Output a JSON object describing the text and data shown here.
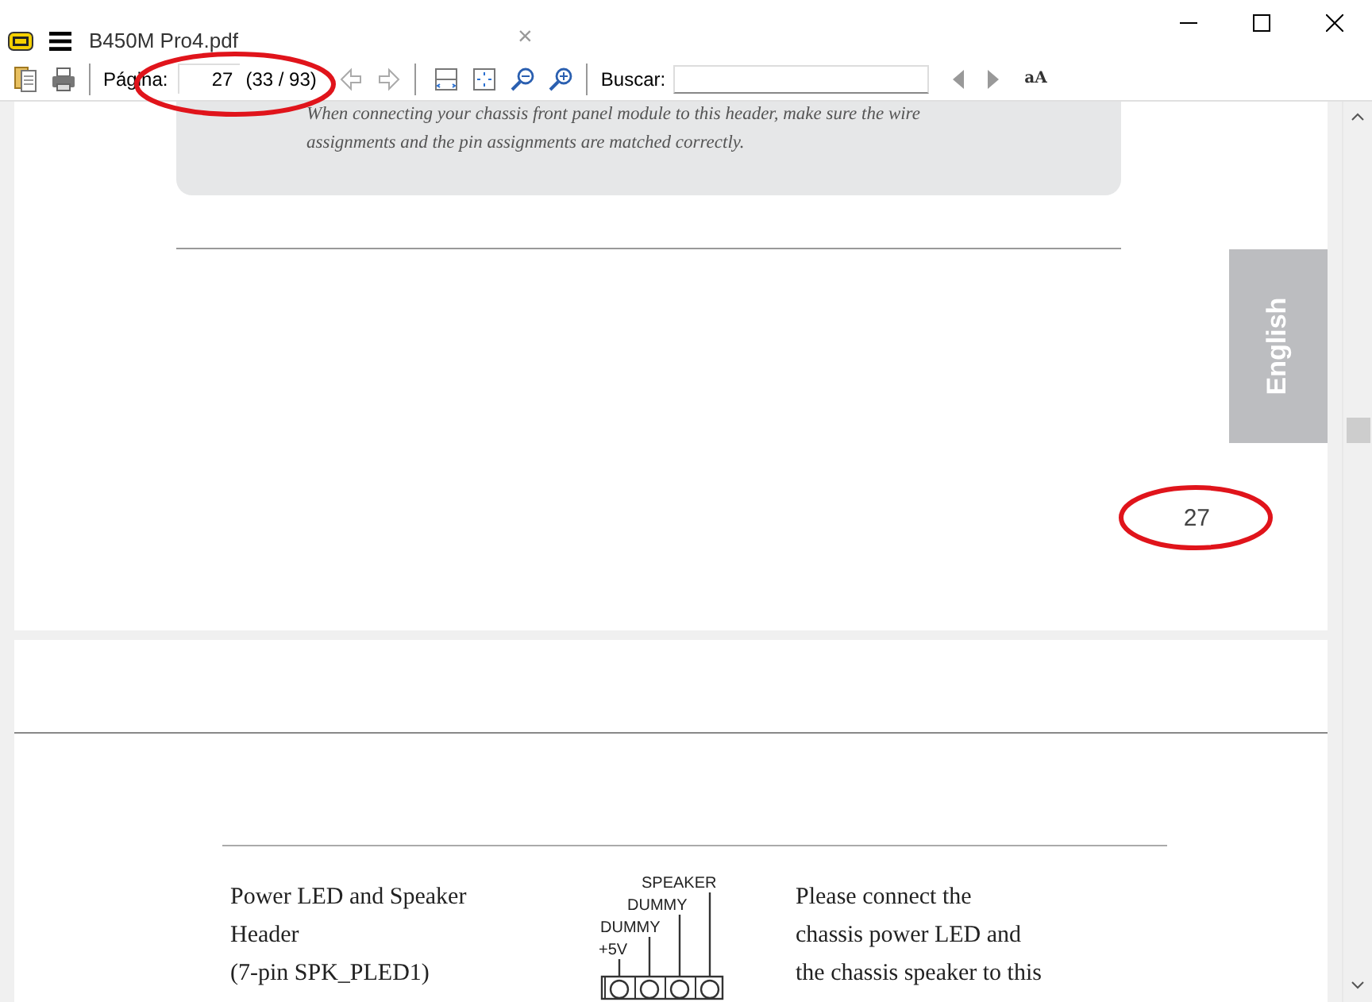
{
  "window": {
    "title": "B450M Pro4.pdf",
    "tab_close": "×"
  },
  "toolbar": {
    "page_label": "Página:",
    "page_value": "27",
    "page_count": "(33 / 93)",
    "search_label": "Buscar:",
    "text_size_glyph": "aA"
  },
  "page_one": {
    "note_lines": [
      "When connecting your chassis front panel module to this header, make sure the wire",
      "assignments and the pin assignments are matched correctly."
    ],
    "side_tab": "English",
    "page_number": "27"
  },
  "page_two": {
    "title_lines": [
      "Power LED and Speaker",
      "Header",
      "(7-pin SPK_PLED1)"
    ],
    "pin_labels": [
      "SPEAKER",
      "DUMMY",
      "DUMMY",
      "+5V"
    ],
    "description_lines": [
      "Please connect the",
      "chassis power LED and",
      "the chassis speaker to this"
    ]
  }
}
